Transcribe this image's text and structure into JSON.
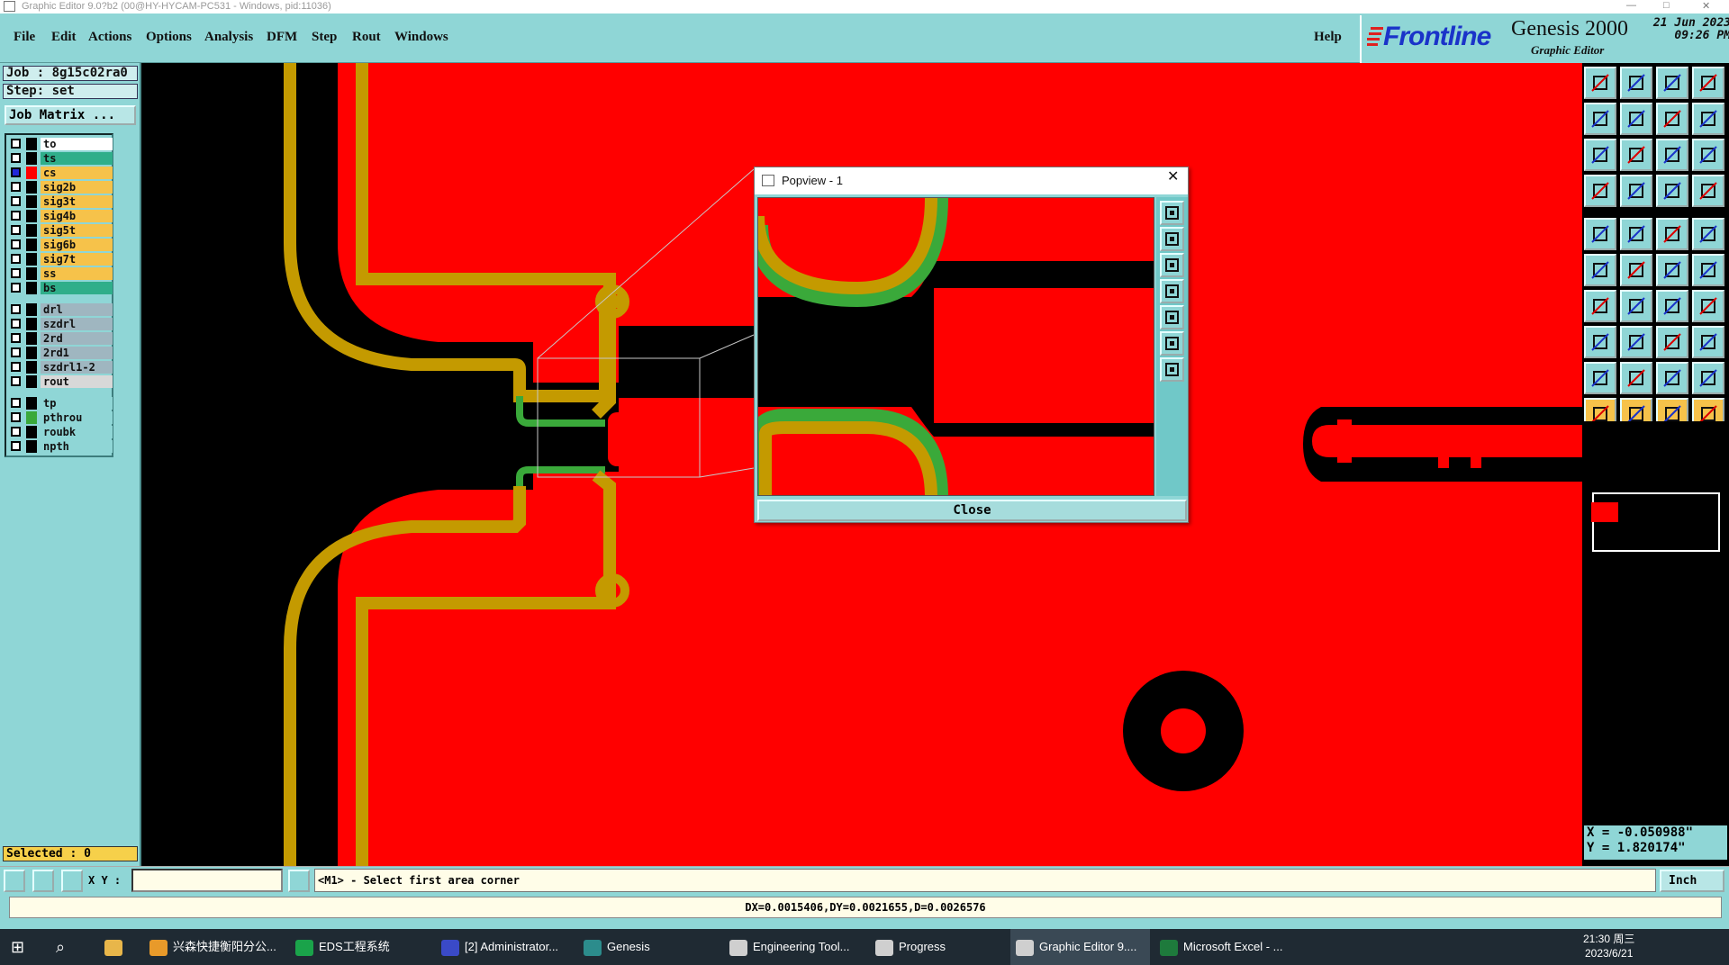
{
  "window": {
    "title": "Graphic Editor 9.0?b2 (00@HY-HYCAM-PC531 - Windows, pid:11036)"
  },
  "menu": {
    "items": [
      "File",
      "Edit",
      "Actions",
      "Options",
      "Analysis",
      "DFM",
      "Step",
      "Rout",
      "Windows"
    ],
    "help": "Help"
  },
  "brand": {
    "company": "Frontline",
    "product": "Genesis 2000",
    "subtitle": "Graphic Editor",
    "date": "21 Jun 2023",
    "time": "09:26 PM"
  },
  "job": {
    "job_label": "Job : 8g15c02ra0",
    "step_label": "Step: set",
    "matrix_button": "Job Matrix ..."
  },
  "layers": [
    {
      "name": "to",
      "bg": "#ffffff",
      "swatch": "#000000",
      "checked": false
    },
    {
      "name": "ts",
      "bg": "#2fae8a",
      "swatch": "#000000",
      "checked": false
    },
    {
      "name": "cs",
      "bg": "#f6c24a",
      "swatch": "#ff0000",
      "checked": true
    },
    {
      "name": "sig2b",
      "bg": "#f6c24a",
      "swatch": "#000000",
      "checked": false
    },
    {
      "name": "sig3t",
      "bg": "#f6c24a",
      "swatch": "#000000",
      "checked": false
    },
    {
      "name": "sig4b",
      "bg": "#f6c24a",
      "swatch": "#000000",
      "checked": false
    },
    {
      "name": "sig5t",
      "bg": "#f6c24a",
      "swatch": "#000000",
      "checked": false
    },
    {
      "name": "sig6b",
      "bg": "#f6c24a",
      "swatch": "#000000",
      "checked": false
    },
    {
      "name": "sig7t",
      "bg": "#f6c24a",
      "swatch": "#000000",
      "checked": false
    },
    {
      "name": "ss",
      "bg": "#f6c24a",
      "swatch": "#000000",
      "checked": false
    },
    {
      "name": "bs",
      "bg": "#2fae8a",
      "swatch": "#000000",
      "checked": false
    },
    {
      "name": "drl",
      "bg": "#9fb6c0",
      "swatch": "#000000",
      "checked": false
    },
    {
      "name": "szdrl",
      "bg": "#9fb6c0",
      "swatch": "#000000",
      "checked": false
    },
    {
      "name": "2rd",
      "bg": "#9fb6c0",
      "swatch": "#000000",
      "checked": false
    },
    {
      "name": "2rd1",
      "bg": "#9fb6c0",
      "swatch": "#000000",
      "checked": false
    },
    {
      "name": "szdrl1-2",
      "bg": "#9fb6c0",
      "swatch": "#000000",
      "checked": false
    },
    {
      "name": "rout",
      "bg": "#d8d8d8",
      "swatch": "#000000",
      "checked": false
    },
    {
      "name": "tp",
      "bg": "#8fd6d6",
      "swatch": "#000000",
      "checked": false
    },
    {
      "name": "pthrou",
      "bg": "#8fd6d6",
      "swatch": "#3aa93a",
      "checked": false
    },
    {
      "name": "roubk",
      "bg": "#8fd6d6",
      "swatch": "#000000",
      "checked": false
    },
    {
      "name": "npth",
      "bg": "#8fd6d6",
      "swatch": "#000000",
      "checked": false
    }
  ],
  "selected": "Selected : 0",
  "coords": {
    "x": "X = -0.050988\"",
    "y": "Y = 1.820174\""
  },
  "popview": {
    "title": "Popview - 1",
    "close": "Close"
  },
  "status": {
    "xy_label": "X Y :",
    "prompt": "<M1> - Select first area corner",
    "units": "Inch",
    "measure": "DX=0.0015406,DY=0.0021655,D=0.0026576"
  },
  "taskbar": {
    "items": [
      "兴森快捷衡阳分公...",
      "EDS工程系统",
      "[2] Administrator...",
      "Genesis",
      "Engineering Tool...",
      "Progress",
      "Graphic Editor 9....",
      "Microsoft Excel - ..."
    ],
    "time": "21:30 周三",
    "date": "2023/6/21"
  },
  "colors": {
    "board": "#ff0000",
    "copper_trace": "#c49a00",
    "green_trace": "#3aa93a",
    "ui_teal": "#8fd6d6"
  }
}
